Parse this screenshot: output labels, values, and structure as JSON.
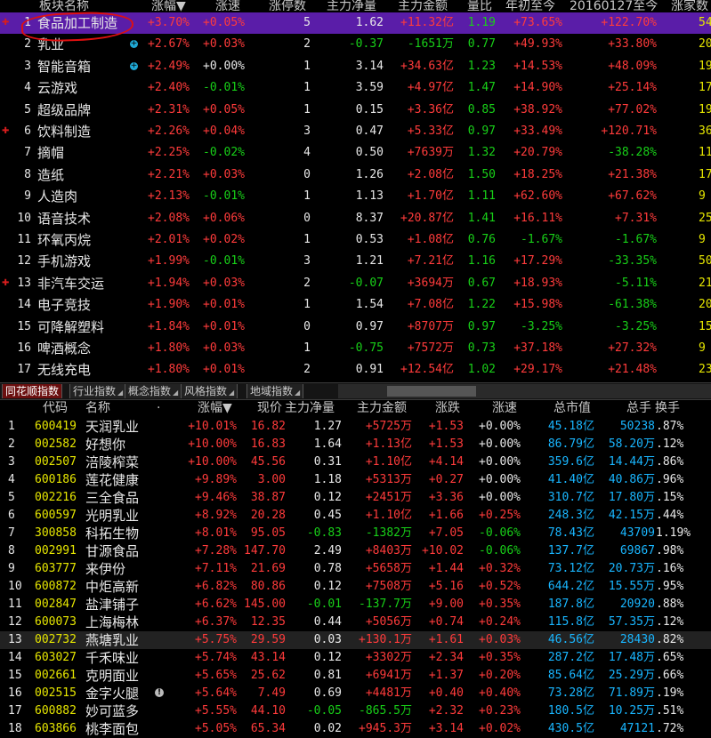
{
  "sector_table": {
    "headers": {
      "name": "板块名称",
      "change": "涨幅",
      "sort_arrow": "▼",
      "speed": "涨速",
      "limit_up": "涨停数",
      "main_net": "主力净量",
      "main_amount": "主力金额",
      "volume_ratio": "量比",
      "ytd": "年初至今",
      "since": "20160127至今",
      "up_count": "涨家数"
    },
    "rows": [
      {
        "idx": "1",
        "name": "食品加工制造",
        "mark": "red-plus",
        "change": "+3.70%",
        "speed": "+0.05%",
        "limit": "5",
        "net": "1.62",
        "amount": "+11.32亿",
        "ratio": "1.19",
        "ytd": "+73.65%",
        "since": "+122.70%",
        "up": "54"
      },
      {
        "idx": "2",
        "name": "乳业",
        "mark": "cyan-plus",
        "change": "+2.67%",
        "speed": "+0.03%",
        "limit": "2",
        "net": "-0.37",
        "amount": "-1651万",
        "ratio": "0.77",
        "ytd": "+49.93%",
        "since": "+33.80%",
        "up": "20"
      },
      {
        "idx": "3",
        "name": "智能音箱",
        "mark": "cyan-plus",
        "change": "+2.49%",
        "speed": "+0.00%",
        "limit": "1",
        "net": "3.14",
        "amount": "+34.63亿",
        "ratio": "1.23",
        "ytd": "+14.53%",
        "since": "+48.09%",
        "up": "19"
      },
      {
        "idx": "4",
        "name": "云游戏",
        "mark": "",
        "change": "+2.40%",
        "speed": "-0.01%",
        "limit": "1",
        "net": "3.59",
        "amount": "+4.97亿",
        "ratio": "1.47",
        "ytd": "+14.90%",
        "since": "+25.14%",
        "up": "17"
      },
      {
        "idx": "5",
        "name": "超级品牌",
        "mark": "",
        "change": "+2.31%",
        "speed": "+0.05%",
        "limit": "1",
        "net": "0.15",
        "amount": "+3.36亿",
        "ratio": "0.85",
        "ytd": "+38.92%",
        "since": "+77.02%",
        "up": "19"
      },
      {
        "idx": "6",
        "name": "饮料制造",
        "mark": "red-plus",
        "change": "+2.26%",
        "speed": "+0.04%",
        "limit": "3",
        "net": "0.47",
        "amount": "+5.33亿",
        "ratio": "0.97",
        "ytd": "+33.49%",
        "since": "+120.71%",
        "up": "36"
      },
      {
        "idx": "7",
        "name": "摘帽",
        "mark": "",
        "change": "+2.25%",
        "speed": "-0.02%",
        "limit": "4",
        "net": "0.50",
        "amount": "+7639万",
        "ratio": "1.32",
        "ytd": "+20.79%",
        "since": "-38.28%",
        "up": "11"
      },
      {
        "idx": "8",
        "name": "造纸",
        "mark": "",
        "change": "+2.21%",
        "speed": "+0.03%",
        "limit": "0",
        "net": "1.26",
        "amount": "+2.08亿",
        "ratio": "1.50",
        "ytd": "+18.25%",
        "since": "+21.38%",
        "up": "17"
      },
      {
        "idx": "9",
        "name": "人造肉",
        "mark": "",
        "change": "+2.13%",
        "speed": "-0.01%",
        "limit": "1",
        "net": "1.13",
        "amount": "+1.70亿",
        "ratio": "1.11",
        "ytd": "+62.60%",
        "since": "+67.62%",
        "up": "9"
      },
      {
        "idx": "10",
        "name": "语音技术",
        "mark": "",
        "change": "+2.08%",
        "speed": "+0.06%",
        "limit": "0",
        "net": "8.37",
        "amount": "+20.87亿",
        "ratio": "1.41",
        "ytd": "+16.11%",
        "since": "+7.31%",
        "up": "25"
      },
      {
        "idx": "11",
        "name": "环氧丙烷",
        "mark": "",
        "change": "+2.01%",
        "speed": "+0.02%",
        "limit": "1",
        "net": "0.53",
        "amount": "+1.08亿",
        "ratio": "0.76",
        "ytd": "-1.67%",
        "since": "-1.67%",
        "up": "9"
      },
      {
        "idx": "12",
        "name": "手机游戏",
        "mark": "",
        "change": "+1.99%",
        "speed": "-0.01%",
        "limit": "3",
        "net": "1.21",
        "amount": "+7.21亿",
        "ratio": "1.16",
        "ytd": "+17.29%",
        "since": "-33.35%",
        "up": "50"
      },
      {
        "idx": "13",
        "name": "非汽车交运",
        "mark": "red-plus",
        "change": "+1.94%",
        "speed": "+0.03%",
        "limit": "2",
        "net": "-0.07",
        "amount": "+3694万",
        "ratio": "0.67",
        "ytd": "+18.93%",
        "since": "-5.11%",
        "up": "21"
      },
      {
        "idx": "14",
        "name": "电子竞技",
        "mark": "",
        "change": "+1.90%",
        "speed": "+0.01%",
        "limit": "1",
        "net": "1.54",
        "amount": "+7.08亿",
        "ratio": "1.22",
        "ytd": "+15.98%",
        "since": "-61.38%",
        "up": "20"
      },
      {
        "idx": "15",
        "name": "可降解塑料",
        "mark": "",
        "change": "+1.84%",
        "speed": "+0.01%",
        "limit": "0",
        "net": "0.97",
        "amount": "+8707万",
        "ratio": "0.97",
        "ytd": "-3.25%",
        "since": "-3.25%",
        "up": "15"
      },
      {
        "idx": "16",
        "name": "啤酒概念",
        "mark": "",
        "change": "+1.80%",
        "speed": "+0.03%",
        "limit": "1",
        "net": "-0.75",
        "amount": "+7572万",
        "ratio": "0.73",
        "ytd": "+37.18%",
        "since": "+27.32%",
        "up": "9"
      },
      {
        "idx": "17",
        "name": "无线充电",
        "mark": "",
        "change": "+1.80%",
        "speed": "+0.01%",
        "limit": "2",
        "net": "0.91",
        "amount": "+12.54亿",
        "ratio": "1.02",
        "ytd": "+29.17%",
        "since": "+21.48%",
        "up": "23"
      }
    ]
  },
  "tabs": [
    "同花顺指数",
    "行业指数",
    "概念指数",
    "风格指数",
    "地域指数"
  ],
  "stock_table": {
    "headers": {
      "code": "代码",
      "name": "名称",
      "dot": "·",
      "change": "涨幅",
      "sort_arrow": "▼",
      "price": "现价",
      "main_net": "主力净量",
      "main_amount": "主力金额",
      "delta": "涨跌",
      "speed": "涨速",
      "mcap": "总市值",
      "hands": "总手",
      "turnover": "换手"
    },
    "rows": [
      {
        "idx": "1",
        "code": "600419",
        "name": "天润乳业",
        "icon": "",
        "change": "+10.01%",
        "price": "16.82",
        "net": "1.27",
        "amount": "+5725万",
        "delta": "+1.53",
        "speed": "+0.00%",
        "mcap": "45.18亿",
        "hands": "50238",
        "turnover": ".87%"
      },
      {
        "idx": "2",
        "code": "002582",
        "name": "好想你",
        "icon": "",
        "change": "+10.00%",
        "price": "16.83",
        "net": "1.64",
        "amount": "+1.13亿",
        "delta": "+1.53",
        "speed": "+0.00%",
        "mcap": "86.79亿",
        "hands": "58.20万",
        "turnover": ".12%"
      },
      {
        "idx": "3",
        "code": "002507",
        "name": "涪陵榨菜",
        "icon": "",
        "change": "+10.00%",
        "price": "45.56",
        "net": "0.31",
        "amount": "+1.10亿",
        "delta": "+4.14",
        "speed": "+0.00%",
        "mcap": "359.6亿",
        "hands": "14.44万",
        "turnover": ".86%"
      },
      {
        "idx": "4",
        "code": "600186",
        "name": "莲花健康",
        "icon": "",
        "change": "+9.89%",
        "price": "3.00",
        "net": "1.18",
        "amount": "+5313万",
        "delta": "+0.27",
        "speed": "+0.00%",
        "mcap": "41.40亿",
        "hands": "40.86万",
        "turnover": ".96%"
      },
      {
        "idx": "5",
        "code": "002216",
        "name": "三全食品",
        "icon": "",
        "change": "+9.46%",
        "price": "38.87",
        "net": "0.12",
        "amount": "+2451万",
        "delta": "+3.36",
        "speed": "+0.00%",
        "mcap": "310.7亿",
        "hands": "17.80万",
        "turnover": ".15%"
      },
      {
        "idx": "6",
        "code": "600597",
        "name": "光明乳业",
        "icon": "",
        "change": "+8.92%",
        "price": "20.28",
        "net": "0.45",
        "amount": "+1.10亿",
        "delta": "+1.66",
        "speed": "+0.25%",
        "mcap": "248.3亿",
        "hands": "42.15万",
        "turnover": ".44%"
      },
      {
        "idx": "7",
        "code": "300858",
        "name": "科拓生物",
        "icon": "",
        "change": "+8.01%",
        "price": "95.05",
        "net": "-0.83",
        "amount": "-1382万",
        "delta": "+7.05",
        "speed": "-0.06%",
        "mcap": "78.43亿",
        "hands": "43709",
        "turnover": "1.19%"
      },
      {
        "idx": "8",
        "code": "002991",
        "name": "甘源食品",
        "icon": "",
        "change": "+7.28%",
        "price": "147.70",
        "net": "2.49",
        "amount": "+8403万",
        "delta": "+10.02",
        "speed": "-0.06%",
        "mcap": "137.7亿",
        "hands": "69867",
        "turnover": ".98%"
      },
      {
        "idx": "9",
        "code": "603777",
        "name": "来伊份",
        "icon": "",
        "change": "+7.11%",
        "price": "21.69",
        "net": "0.78",
        "amount": "+5658万",
        "delta": "+1.44",
        "speed": "+0.32%",
        "mcap": "73.12亿",
        "hands": "20.73万",
        "turnover": ".16%"
      },
      {
        "idx": "10",
        "code": "600872",
        "name": "中炬高新",
        "icon": "",
        "change": "+6.82%",
        "price": "80.86",
        "net": "0.12",
        "amount": "+7508万",
        "delta": "+5.16",
        "speed": "+0.52%",
        "mcap": "644.2亿",
        "hands": "15.55万",
        "turnover": ".95%"
      },
      {
        "idx": "11",
        "code": "002847",
        "name": "盐津铺子",
        "icon": "",
        "change": "+6.62%",
        "price": "145.00",
        "net": "-0.01",
        "amount": "-137.7万",
        "delta": "+9.00",
        "speed": "+0.35%",
        "mcap": "187.8亿",
        "hands": "20920",
        "turnover": ".88%"
      },
      {
        "idx": "12",
        "code": "600073",
        "name": "上海梅林",
        "icon": "",
        "change": "+6.37%",
        "price": "12.35",
        "net": "0.44",
        "amount": "+5056万",
        "delta": "+0.74",
        "speed": "+0.24%",
        "mcap": "115.8亿",
        "hands": "57.35万",
        "turnover": ".12%"
      },
      {
        "idx": "13",
        "code": "002732",
        "name": "燕塘乳业",
        "icon": "",
        "change": "+5.75%",
        "price": "29.59",
        "net": "0.03",
        "amount": "+130.1万",
        "delta": "+1.61",
        "speed": "+0.03%",
        "mcap": "46.56亿",
        "hands": "28430",
        "turnover": ".82%"
      },
      {
        "idx": "14",
        "code": "603027",
        "name": "千禾味业",
        "icon": "",
        "change": "+5.74%",
        "price": "43.14",
        "net": "0.12",
        "amount": "+3302万",
        "delta": "+2.34",
        "speed": "+0.35%",
        "mcap": "287.2亿",
        "hands": "17.48万",
        "turnover": ".65%"
      },
      {
        "idx": "15",
        "code": "002661",
        "name": "克明面业",
        "icon": "",
        "change": "+5.65%",
        "price": "25.62",
        "net": "0.81",
        "amount": "+6941万",
        "delta": "+1.37",
        "speed": "+0.20%",
        "mcap": "85.64亿",
        "hands": "25.29万",
        "turnover": ".66%"
      },
      {
        "idx": "16",
        "code": "002515",
        "name": "金字火腿",
        "icon": "info",
        "change": "+5.64%",
        "price": "7.49",
        "net": "0.69",
        "amount": "+4481万",
        "delta": "+0.40",
        "speed": "+0.40%",
        "mcap": "73.28亿",
        "hands": "71.89万",
        "turnover": ".19%"
      },
      {
        "idx": "17",
        "code": "600882",
        "name": "妙可蓝多",
        "icon": "",
        "change": "+5.55%",
        "price": "44.10",
        "net": "-0.05",
        "amount": "-865.5万",
        "delta": "+2.32",
        "speed": "+0.23%",
        "mcap": "180.5亿",
        "hands": "10.25万",
        "turnover": ".51%"
      },
      {
        "idx": "18",
        "code": "603866",
        "name": "桃李面包",
        "icon": "",
        "change": "+5.05%",
        "price": "65.34",
        "net": "0.02",
        "amount": "+945.3万",
        "delta": "+3.14",
        "speed": "+0.02%",
        "mcap": "430.5亿",
        "hands": "47121",
        "turnover": ".72%"
      }
    ]
  }
}
